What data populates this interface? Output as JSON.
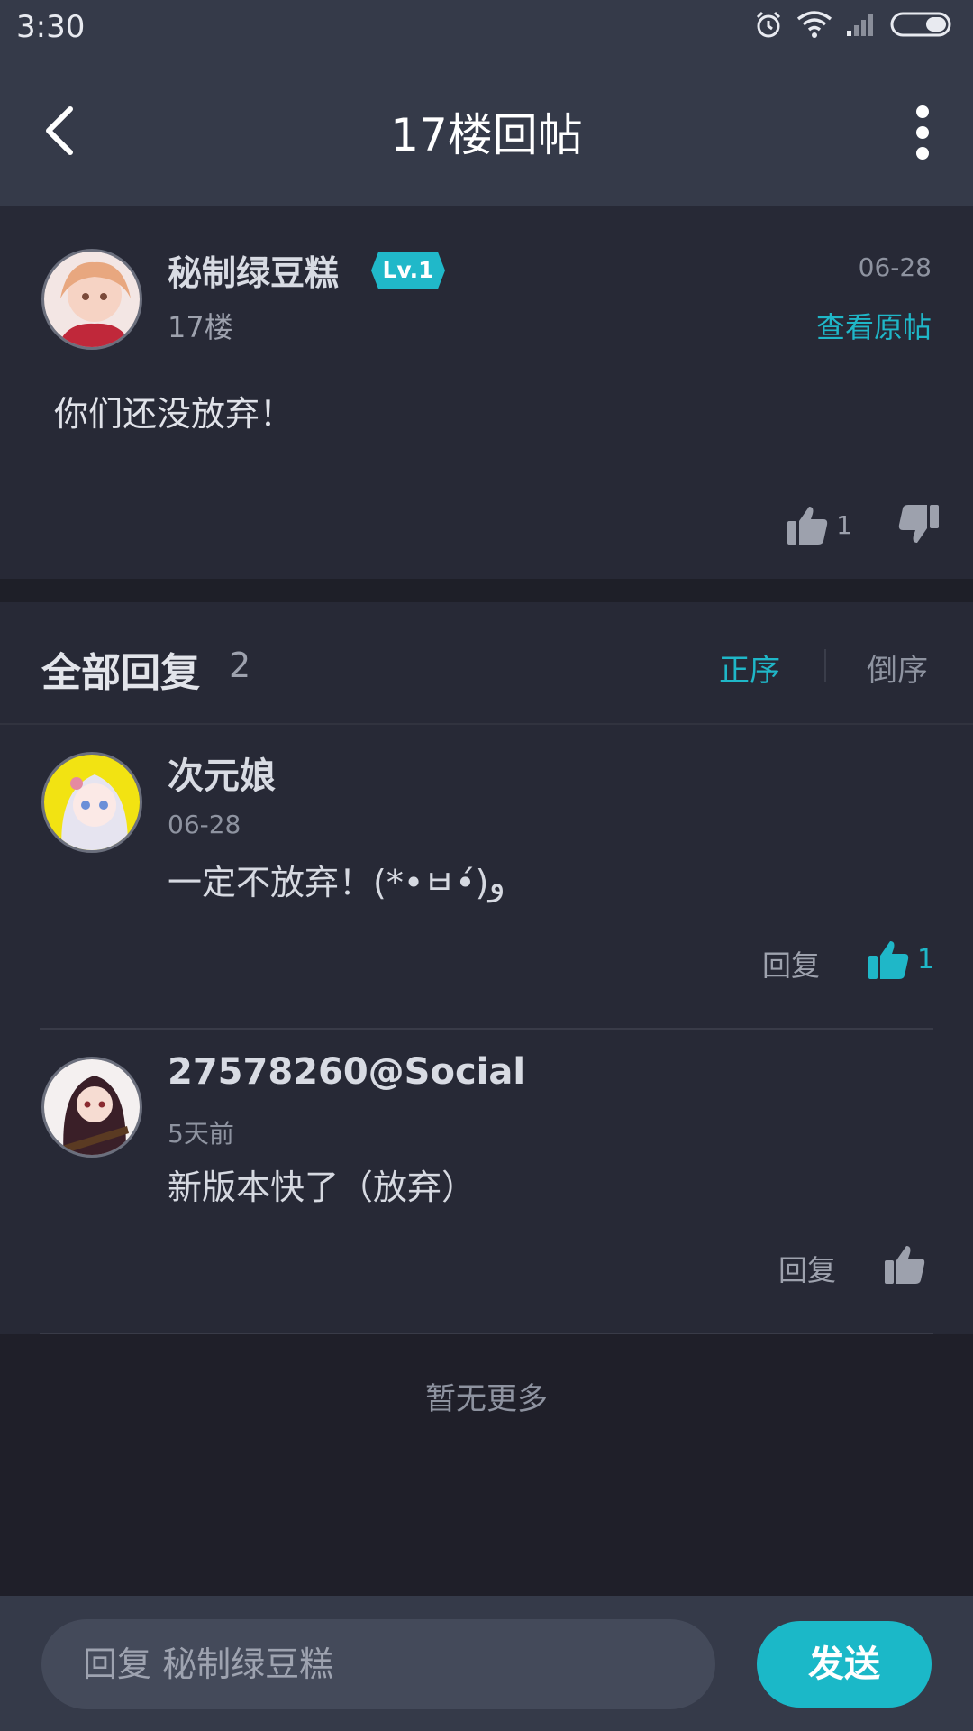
{
  "status_bar": {
    "time": "3:30"
  },
  "header": {
    "title": "17楼回帖"
  },
  "post": {
    "username": "秘制绿豆糕",
    "level": "Lv.1",
    "floor": "17楼",
    "date": "06-28",
    "view_original": "查看原帖",
    "content": "你们还没放弃！",
    "like_count": "1"
  },
  "replies_section": {
    "title": "全部回复",
    "count": "2",
    "sort_asc": "正序",
    "sort_desc": "倒序"
  },
  "replies": [
    {
      "username": "次元娘",
      "date": "06-28",
      "content": "一定不放弃！(*•ㅂ•́)و",
      "reply_label": "回复",
      "like_count": "1",
      "liked": true
    },
    {
      "username": "27578260@Social",
      "date": "5天前",
      "content": "新版本快了（放弃）",
      "reply_label": "回复",
      "like_count": "",
      "liked": false
    }
  ],
  "no_more": "暂无更多",
  "composer": {
    "placeholder": "回复 秘制绿豆糕",
    "send_label": "发送"
  },
  "colors": {
    "accent": "#1fb7c8",
    "background": "#1f1f29",
    "card": "#272936",
    "header": "#353a49"
  }
}
